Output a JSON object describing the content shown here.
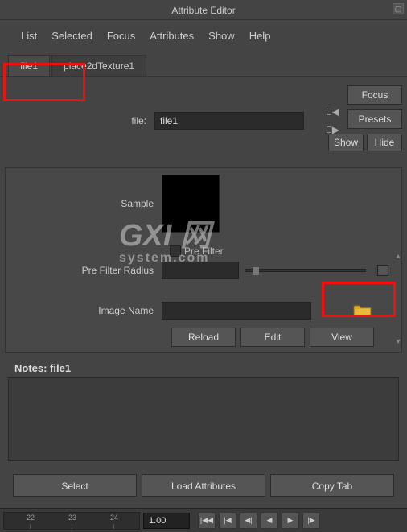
{
  "window": {
    "title": "Attribute Editor"
  },
  "menu": [
    "List",
    "Selected",
    "Focus",
    "Attributes",
    "Show",
    "Help"
  ],
  "tabs": [
    {
      "label": "file1",
      "active": true
    },
    {
      "label": "place2dTexture1",
      "active": false
    }
  ],
  "side": {
    "focus": "Focus",
    "presets": "Presets",
    "show": "Show",
    "hide": "Hide"
  },
  "file_node": {
    "type_label": "file:",
    "name": "file1"
  },
  "sample": {
    "label": "Sample"
  },
  "prefilter": {
    "checkbox_label": "Pre Filter",
    "radius_label": "Pre Filter Radius",
    "radius_value": ""
  },
  "image_name": {
    "label": "Image Name",
    "value": ""
  },
  "buttons": {
    "reload": "Reload",
    "edit": "Edit",
    "view": "View"
  },
  "notes": {
    "label": "Notes: file1"
  },
  "bottom": {
    "select": "Select",
    "load": "Load Attributes",
    "copy": "Copy Tab"
  },
  "timeline": {
    "frames": [
      "22",
      "23",
      "24"
    ],
    "current": "1.00"
  },
  "watermark": {
    "big": "GXI 网",
    "sub": "system.com"
  }
}
